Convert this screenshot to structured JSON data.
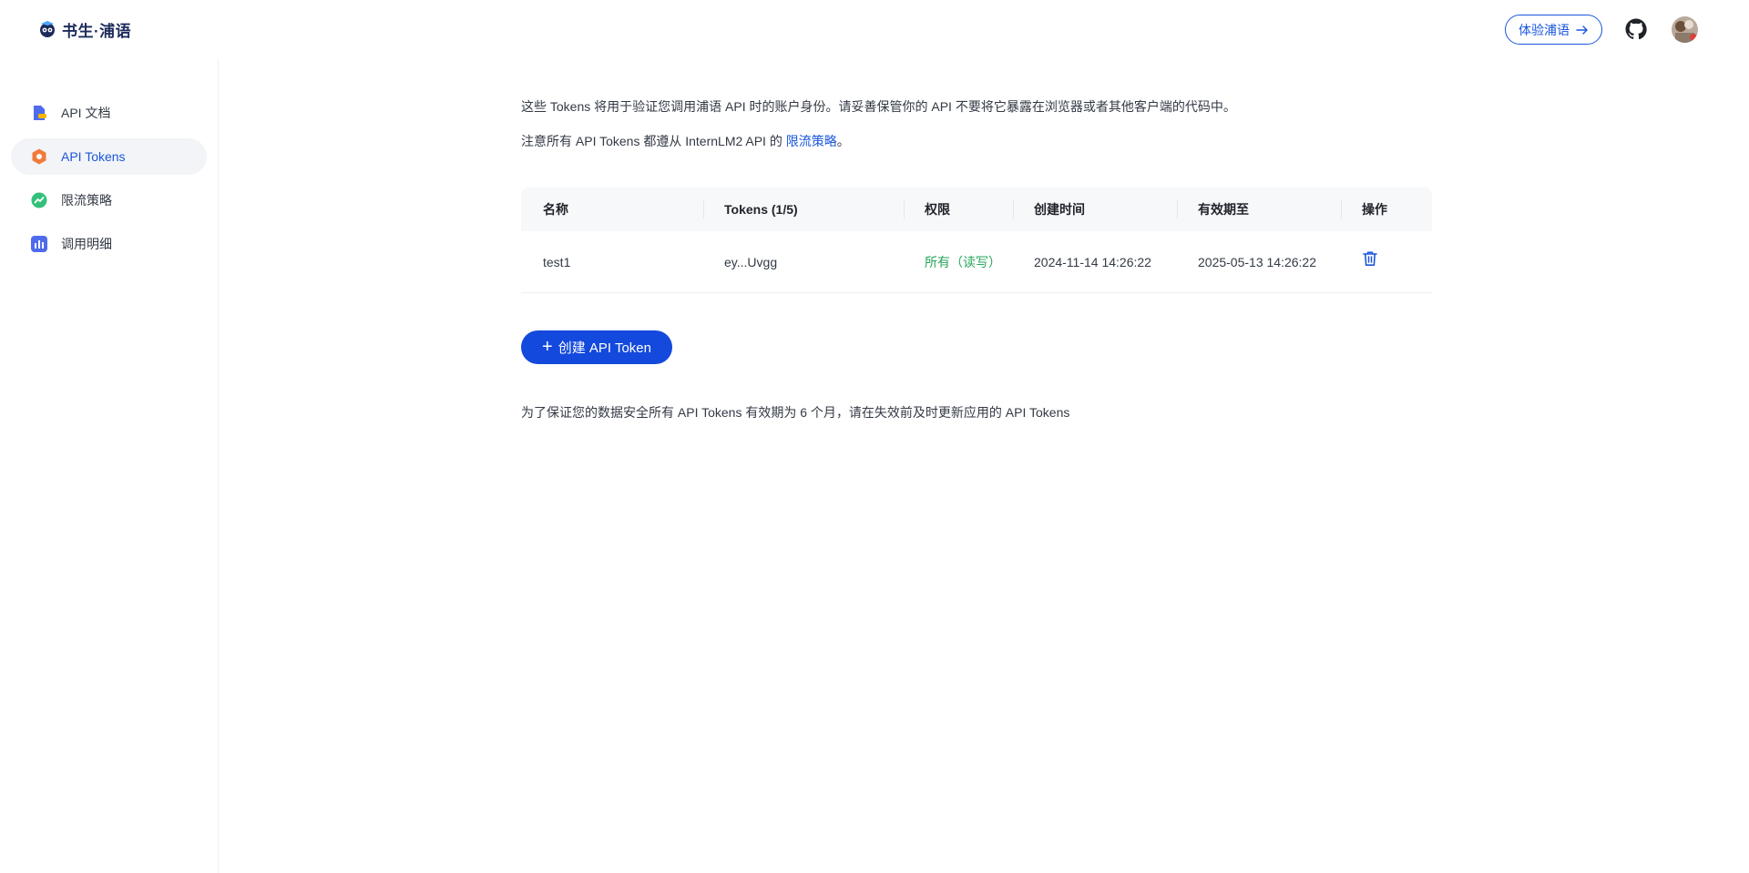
{
  "header": {
    "logo_text": "书生·浦语",
    "try_button_label": "体验浦语"
  },
  "sidebar": {
    "items": [
      {
        "label": "API 文档",
        "icon": "document-icon",
        "active": false
      },
      {
        "label": "API Tokens",
        "icon": "token-icon",
        "active": true
      },
      {
        "label": "限流策略",
        "icon": "rate-limit-icon",
        "active": false
      },
      {
        "label": "调用明细",
        "icon": "usage-chart-icon",
        "active": false
      }
    ]
  },
  "main": {
    "description_1": "这些 Tokens 将用于验证您调用浦语 API 时的账户身份。请妥善保管你的 API 不要将它暴露在浏览器或者其他客户端的代码中。",
    "description_2_prefix": "注意所有 API Tokens 都遵从 InternLM2 API 的 ",
    "description_2_link": "限流策略",
    "description_2_suffix": "。",
    "table": {
      "headers": [
        "名称",
        "Tokens (1/5)",
        "权限",
        "创建时间",
        "有效期至",
        "操作"
      ],
      "rows": [
        {
          "name": "test1",
          "token": "ey...Uvgg",
          "permission": "所有（读写）",
          "created": "2024-11-14 14:26:22",
          "expires": "2025-05-13 14:26:22",
          "action_icon": "trash-icon"
        }
      ]
    },
    "create_button_label": "创建 API Token",
    "note": "为了保证您的数据安全所有 API Tokens 有效期为 6 个月，请在失效前及时更新应用的 API Tokens"
  },
  "colors": {
    "accent": "#1a56db",
    "button_bg": "#1349dc",
    "permission_green": "#27a65a"
  }
}
